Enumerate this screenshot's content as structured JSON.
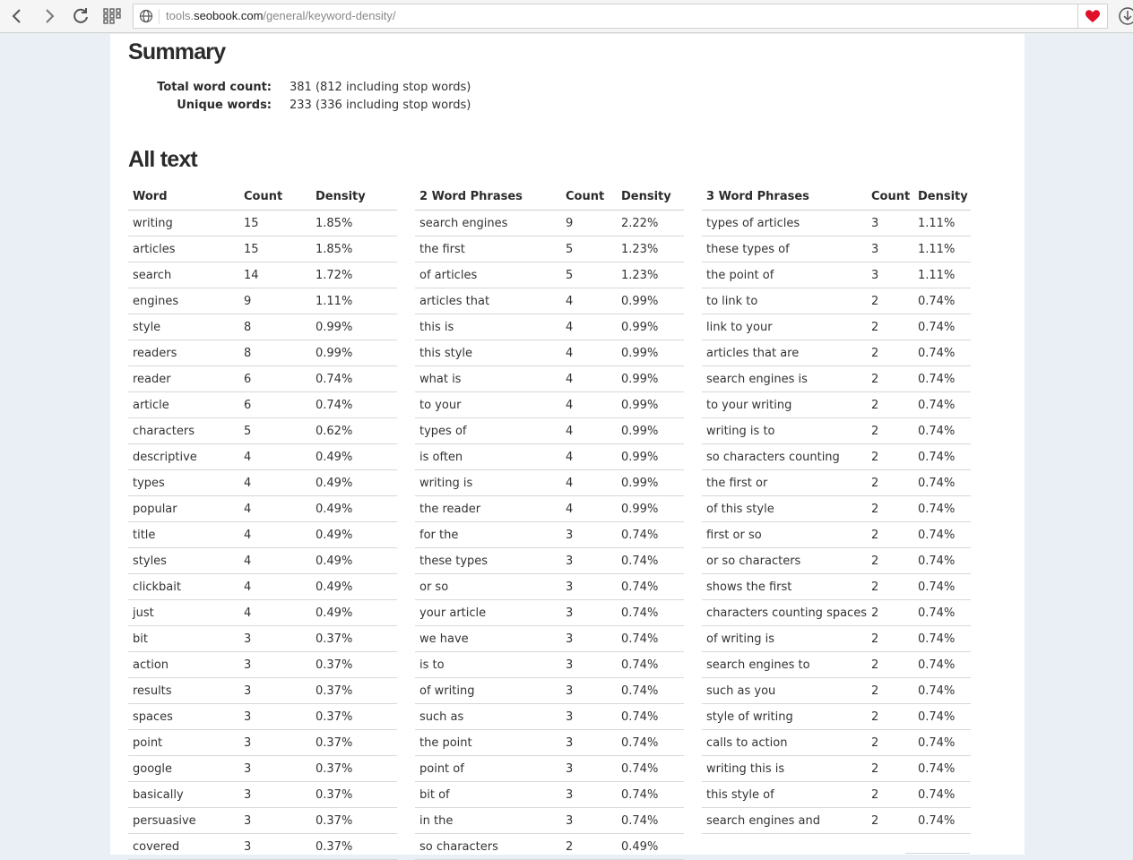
{
  "browser": {
    "url_prefix": "tools.",
    "url_domain": "seobook.com",
    "url_path": "/general/keyword-density/"
  },
  "summary": {
    "title": "Summary",
    "total_label": "Total word count:",
    "total_value": "381 (812 including stop words)",
    "unique_label": "Unique words:",
    "unique_value": "233 (336 including stop words)"
  },
  "all_text": {
    "title": "All text",
    "words": {
      "headers": [
        "Word",
        "Count",
        "Density"
      ],
      "rows": [
        [
          "writing",
          "15",
          "1.85%"
        ],
        [
          "articles",
          "15",
          "1.85%"
        ],
        [
          "search",
          "14",
          "1.72%"
        ],
        [
          "engines",
          "9",
          "1.11%"
        ],
        [
          "style",
          "8",
          "0.99%"
        ],
        [
          "readers",
          "8",
          "0.99%"
        ],
        [
          "reader",
          "6",
          "0.74%"
        ],
        [
          "article",
          "6",
          "0.74%"
        ],
        [
          "characters",
          "5",
          "0.62%"
        ],
        [
          "descriptive",
          "4",
          "0.49%"
        ],
        [
          "types",
          "4",
          "0.49%"
        ],
        [
          "popular",
          "4",
          "0.49%"
        ],
        [
          "title",
          "4",
          "0.49%"
        ],
        [
          "styles",
          "4",
          "0.49%"
        ],
        [
          "clickbait",
          "4",
          "0.49%"
        ],
        [
          "just",
          "4",
          "0.49%"
        ],
        [
          "bit",
          "3",
          "0.37%"
        ],
        [
          "action",
          "3",
          "0.37%"
        ],
        [
          "results",
          "3",
          "0.37%"
        ],
        [
          "spaces",
          "3",
          "0.37%"
        ],
        [
          "point",
          "3",
          "0.37%"
        ],
        [
          "google",
          "3",
          "0.37%"
        ],
        [
          "basically",
          "3",
          "0.37%"
        ],
        [
          "persuasive",
          "3",
          "0.37%"
        ],
        [
          "covered",
          "3",
          "0.37%"
        ]
      ]
    },
    "two_word": {
      "headers": [
        "2 Word Phrases",
        "Count",
        "Density"
      ],
      "rows": [
        [
          "search engines",
          "9",
          "2.22%"
        ],
        [
          "the first",
          "5",
          "1.23%"
        ],
        [
          "of articles",
          "5",
          "1.23%"
        ],
        [
          "articles that",
          "4",
          "0.99%"
        ],
        [
          "this is",
          "4",
          "0.99%"
        ],
        [
          "this style",
          "4",
          "0.99%"
        ],
        [
          "what is",
          "4",
          "0.99%"
        ],
        [
          "to your",
          "4",
          "0.99%"
        ],
        [
          "types of",
          "4",
          "0.99%"
        ],
        [
          "is often",
          "4",
          "0.99%"
        ],
        [
          "writing is",
          "4",
          "0.99%"
        ],
        [
          "the reader",
          "4",
          "0.99%"
        ],
        [
          "for the",
          "3",
          "0.74%"
        ],
        [
          "these types",
          "3",
          "0.74%"
        ],
        [
          "or so",
          "3",
          "0.74%"
        ],
        [
          "your article",
          "3",
          "0.74%"
        ],
        [
          "we have",
          "3",
          "0.74%"
        ],
        [
          "is to",
          "3",
          "0.74%"
        ],
        [
          "of writing",
          "3",
          "0.74%"
        ],
        [
          "such as",
          "3",
          "0.74%"
        ],
        [
          "the point",
          "3",
          "0.74%"
        ],
        [
          "point of",
          "3",
          "0.74%"
        ],
        [
          "bit of",
          "3",
          "0.74%"
        ],
        [
          "in the",
          "3",
          "0.74%"
        ],
        [
          "so characters",
          "2",
          "0.49%"
        ]
      ]
    },
    "three_word": {
      "headers": [
        "3 Word Phrases",
        "Count",
        "Density"
      ],
      "rows": [
        [
          "types of articles",
          "3",
          "1.11%"
        ],
        [
          "these types of",
          "3",
          "1.11%"
        ],
        [
          "the point of",
          "3",
          "1.11%"
        ],
        [
          "to link to",
          "2",
          "0.74%"
        ],
        [
          "link to your",
          "2",
          "0.74%"
        ],
        [
          "articles that are",
          "2",
          "0.74%"
        ],
        [
          "search engines is",
          "2",
          "0.74%"
        ],
        [
          "to your writing",
          "2",
          "0.74%"
        ],
        [
          "writing is to",
          "2",
          "0.74%"
        ],
        [
          "so characters counting",
          "2",
          "0.74%"
        ],
        [
          "the first or",
          "2",
          "0.74%"
        ],
        [
          "of this style",
          "2",
          "0.74%"
        ],
        [
          "first or so",
          "2",
          "0.74%"
        ],
        [
          "or so characters",
          "2",
          "0.74%"
        ],
        [
          "shows the first",
          "2",
          "0.74%"
        ],
        [
          "characters counting spaces",
          "2",
          "0.74%"
        ],
        [
          "of writing is",
          "2",
          "0.74%"
        ],
        [
          "search engines to",
          "2",
          "0.74%"
        ],
        [
          "such as you",
          "2",
          "0.74%"
        ],
        [
          "style of writing",
          "2",
          "0.74%"
        ],
        [
          "calls to action",
          "2",
          "0.74%"
        ],
        [
          "writing this is",
          "2",
          "0.74%"
        ],
        [
          "this style of",
          "2",
          "0.74%"
        ],
        [
          "search engines and",
          "2",
          "0.74%"
        ]
      ]
    }
  },
  "icons": {
    "back": "back-arrow-icon",
    "forward": "forward-arrow-icon",
    "reload": "reload-icon",
    "apps": "apps-grid-icon",
    "site": "globe-icon",
    "favorite": "heart-icon",
    "download": "download-icon"
  },
  "colors": {
    "heart": "#e0102a",
    "page_bg": "#e9eff4"
  }
}
